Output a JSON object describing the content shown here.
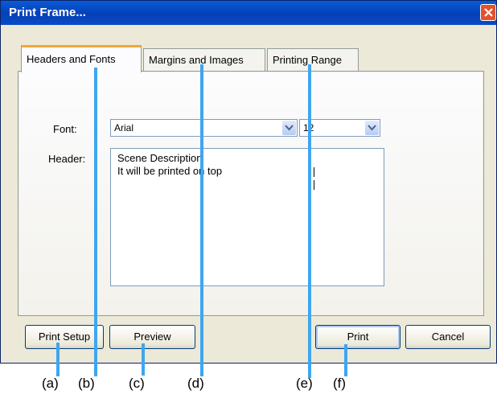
{
  "window": {
    "title": "Print Frame..."
  },
  "tabs": [
    {
      "label": "Headers and Fonts",
      "active": true
    },
    {
      "label": "Margins and Images",
      "active": false
    },
    {
      "label": "Printing Range",
      "active": false
    }
  ],
  "form": {
    "font_label": "Font:",
    "font_value": "Arial",
    "size_value": "12",
    "header_label": "Header:",
    "header_line1": "Scene Description",
    "header_line2": "It will be printed on top"
  },
  "buttons": {
    "print_setup": "Print Setup",
    "preview": "Preview",
    "print": "Print",
    "cancel": "Cancel"
  },
  "annotations": [
    "(a)",
    "(b)",
    "(c)",
    "(d)",
    "(e)",
    "(f)"
  ],
  "colors": {
    "titlebar": "#0440b8",
    "pointer": "#3fa6ef",
    "active_tab_accent": "#f3a63a",
    "close_button": "#e1532e"
  },
  "icons": [
    "close-icon",
    "dropdown-arrow-icon"
  ]
}
